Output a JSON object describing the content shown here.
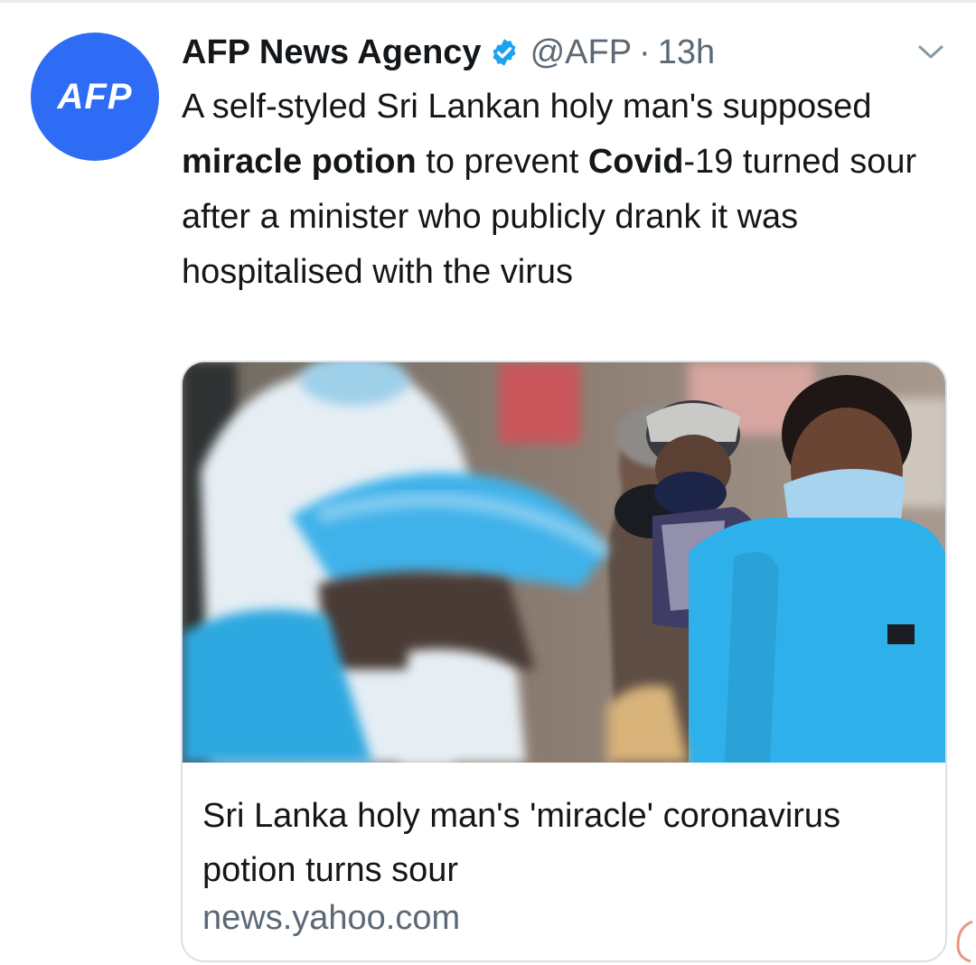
{
  "tweet": {
    "avatar_text": "AFP",
    "author_name": "AFP News Agency",
    "handle": "@AFP",
    "separator": "·",
    "time": "13h",
    "verified_icon": "verified-badge-icon",
    "menu_icon": "chevron-down-icon",
    "text_parts": [
      "A self-styled Sri Lankan holy man's supposed ",
      "miracle potion",
      " to prevent ",
      "Covid",
      "-19 turned sour after a minister who publicly drank it was hospitalised with the virus"
    ]
  },
  "card": {
    "title": "Sri Lanka holy man's 'miracle' coronavirus potion turns sour",
    "domain": "news.yahoo.com"
  },
  "colors": {
    "avatar_bg": "#2e6cf6",
    "verified": "#1da1f2",
    "secondary_text": "#5b6875",
    "card_border": "#d9e1e8"
  }
}
